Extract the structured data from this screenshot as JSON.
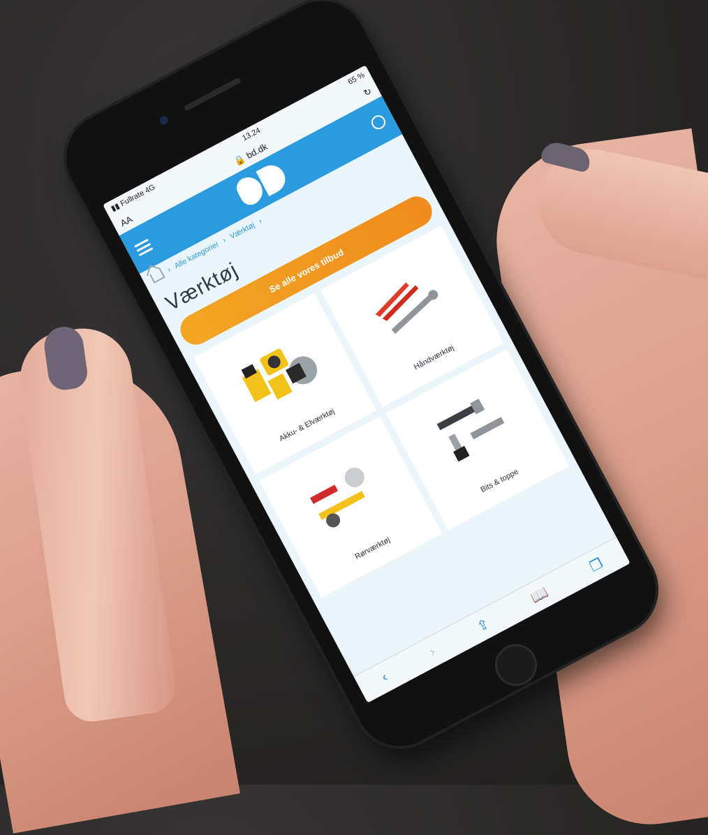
{
  "status_bar": {
    "carrier": "Fullrate",
    "network": "4G",
    "time": "13.24",
    "battery": "65 %"
  },
  "browser": {
    "text_size": "AA",
    "url": "bd.dk",
    "reload_icon": "reload-icon"
  },
  "header": {
    "brand_color": "#2b9be0"
  },
  "breadcrumb": {
    "items": [
      "Alle kategorier",
      "Værktøj"
    ]
  },
  "page": {
    "title": "Værktøj"
  },
  "offer_button": {
    "label": "Se alle vores tilbud",
    "color": "#f2a623"
  },
  "categories": [
    {
      "label": "Akku- & Elværktøj"
    },
    {
      "label": "Håndværktøj"
    },
    {
      "label": "Rørværktøj"
    },
    {
      "label": "Bits & toppe"
    }
  ],
  "toolbar": {
    "icons": [
      "back-icon",
      "forward-icon",
      "share-icon",
      "bookmarks-icon",
      "tabs-icon"
    ]
  }
}
